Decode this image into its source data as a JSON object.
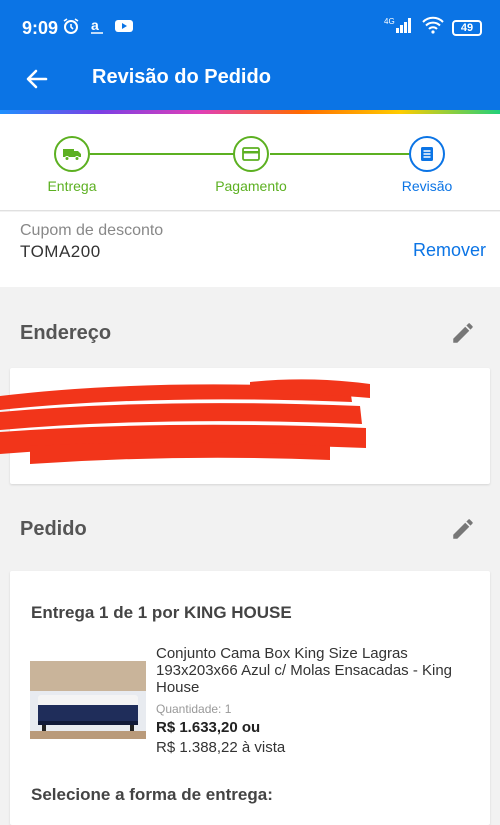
{
  "status_bar": {
    "time": "9:09",
    "network": "4G",
    "battery": "49",
    "icons": [
      "alarm-icon",
      "amazon-icon",
      "youtube-icon",
      "signal-icon",
      "wifi-icon",
      "battery-icon"
    ]
  },
  "app_bar": {
    "title": "Revisão do Pedido",
    "back_icon": "arrow-left-icon",
    "color": "#0b74e5"
  },
  "stepper": {
    "steps": [
      {
        "label": "Entrega",
        "icon": "truck-icon",
        "state": "done"
      },
      {
        "label": "Pagamento",
        "icon": "card-icon",
        "state": "done"
      },
      {
        "label": "Revisão",
        "icon": "document-icon",
        "state": "active"
      }
    ],
    "done_color": "#5cb021",
    "active_color": "#0b74e5"
  },
  "coupon": {
    "caption": "Cupom de desconto",
    "code": "TOMA200",
    "remove_label": "Remover"
  },
  "address_section": {
    "title": "Endereço",
    "edit_icon": "pencil-icon",
    "redacted": true
  },
  "order_section": {
    "title": "Pedido",
    "edit_icon": "pencil-icon",
    "delivery_header": "Entrega 1 de 1 por KING HOUSE",
    "product": {
      "name": "Conjunto Cama Box King Size Lagras 193x203x66 Azul c/ Molas Ensacadas - King House",
      "quantity": "Quantidade: 1",
      "price": "R$ 1.633,20 ou",
      "cash_price": "R$ 1.388,22 à vista"
    },
    "shipping_prompt": "Selecione a forma de entrega:"
  }
}
